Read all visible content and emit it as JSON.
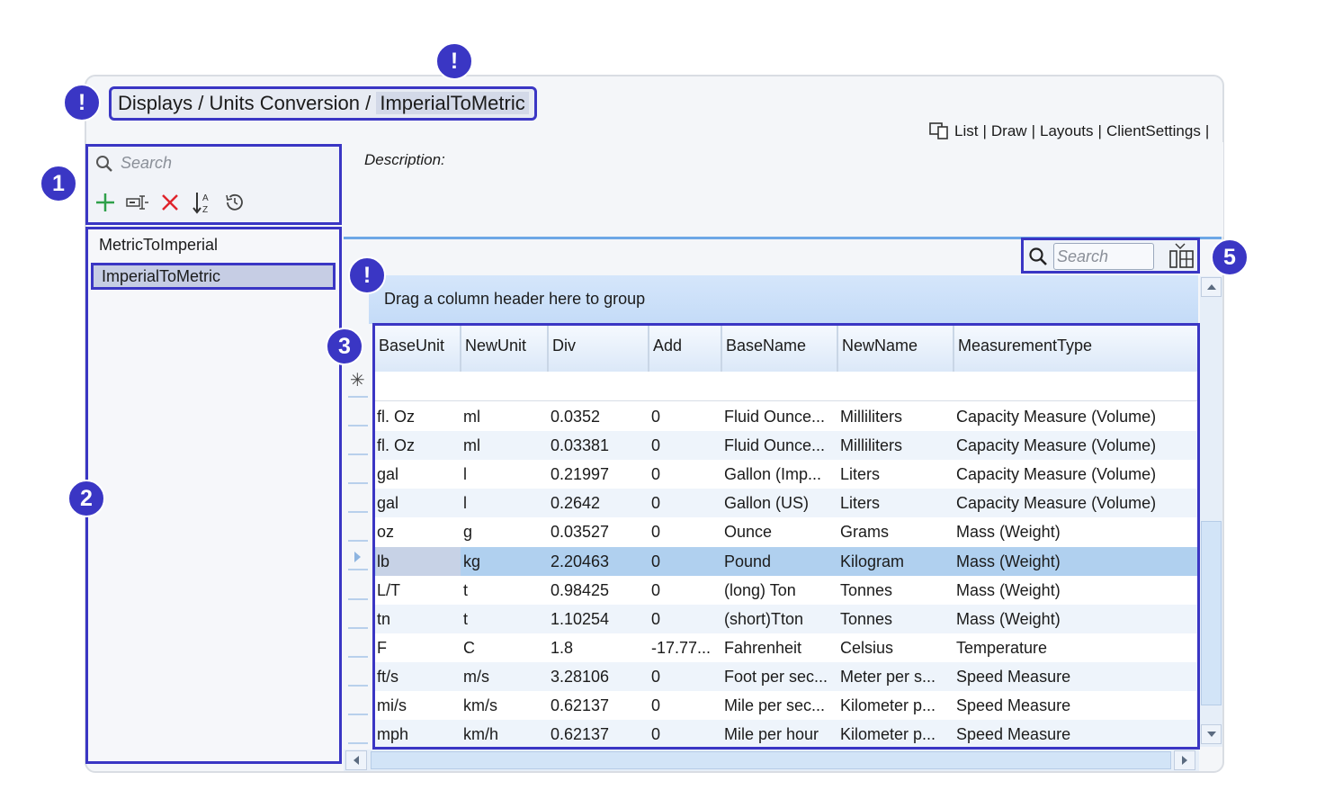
{
  "breadcrumb": {
    "path": "Displays / Units Conversion /",
    "current": "ImperialToMetric"
  },
  "view_links": {
    "list": "List",
    "draw": "Draw",
    "layouts": "Layouts",
    "client_settings": "ClientSettings",
    "sep": "|"
  },
  "callouts": {
    "b1": "1",
    "b2": "2",
    "b3": "3",
    "b5": "5",
    "warn": "!"
  },
  "left_panel": {
    "search_placeholder": "Search",
    "tools": [
      "add-icon",
      "rename-icon",
      "delete-icon",
      "sort-icon",
      "history-icon"
    ],
    "items": [
      {
        "label": "MetricToImperial",
        "selected": false
      },
      {
        "label": "ImperialToMetric",
        "selected": true
      }
    ]
  },
  "description": {
    "label": "Description:"
  },
  "grid": {
    "search_placeholder": "Search",
    "group_panel_text": "Drag a column header here to group",
    "new_row_marker": "✳",
    "columns": [
      "BaseUnit",
      "NewUnit",
      "Div",
      "Add",
      "BaseName",
      "NewName",
      "MeasurementType"
    ],
    "rows": [
      [
        "fl. Oz",
        "ml",
        "0.0352",
        "0",
        "Fluid Ounce...",
        "Milliliters",
        "Capacity Measure (Volume)"
      ],
      [
        "fl. Oz",
        "ml",
        "0.03381",
        "0",
        "Fluid Ounce...",
        "Milliliters",
        "Capacity Measure (Volume)"
      ],
      [
        "gal",
        "l",
        "0.21997",
        "0",
        "Gallon (Imp...",
        "Liters",
        "Capacity Measure (Volume)"
      ],
      [
        "gal",
        "l",
        "0.2642",
        "0",
        "Gallon (US)",
        "Liters",
        "Capacity Measure (Volume)"
      ],
      [
        "oz",
        "g",
        "0.03527",
        "0",
        "Ounce",
        "Grams",
        "Mass (Weight)"
      ],
      [
        "lb",
        "kg",
        "2.20463",
        "0",
        "Pound",
        "Kilogram",
        "Mass (Weight)"
      ],
      [
        "L/T",
        "t",
        "0.98425",
        "0",
        "(long) Ton",
        "Tonnes",
        "Mass (Weight)"
      ],
      [
        "tn",
        "t",
        "1.10254",
        "0",
        "(short)Tton",
        "Tonnes",
        "Mass (Weight)"
      ],
      [
        "F",
        "C",
        "1.8",
        "-17.77...",
        "Fahrenheit",
        "Celsius",
        "Temperature"
      ],
      [
        "ft/s",
        "m/s",
        "3.28106",
        "0",
        "Foot per sec...",
        "Meter per s...",
        "Speed Measure"
      ],
      [
        "mi/s",
        "km/s",
        "0.62137",
        "0",
        "Mile per sec...",
        "Kilometer p...",
        "Speed Measure"
      ],
      [
        "mph",
        "km/h",
        "0.62137",
        "0",
        "Mile per hour",
        "Kilometer p...",
        "Speed Measure"
      ]
    ],
    "selected_row": 5
  },
  "colors": {
    "accent": "#3a36c4",
    "selection": "#b0d0ef",
    "header": "#dbe8f8"
  }
}
